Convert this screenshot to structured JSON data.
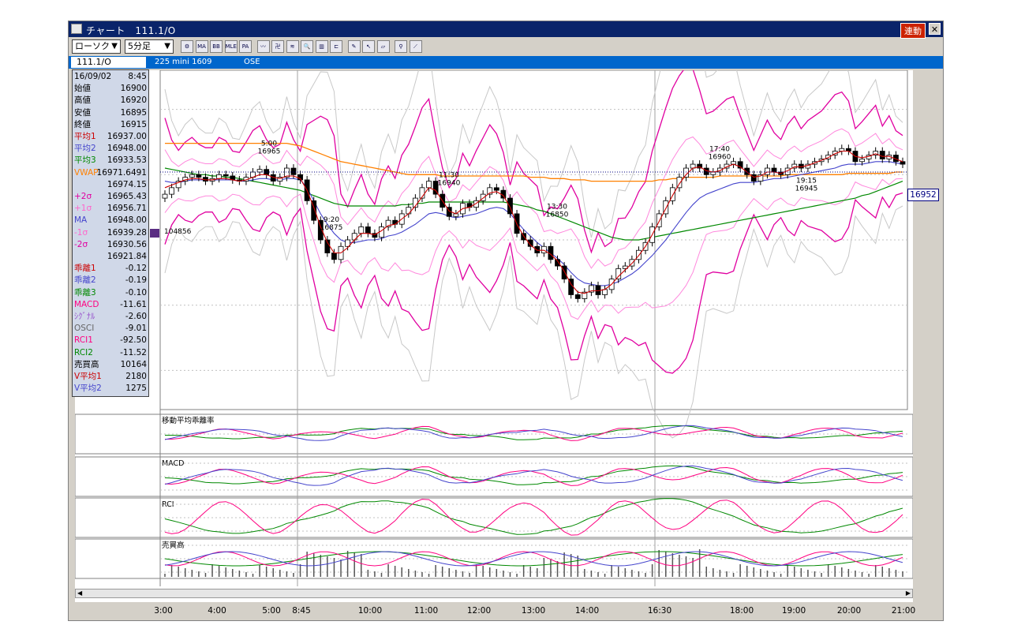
{
  "window": {
    "title": "チャート　111.1/O",
    "rendo_label": "連動",
    "close_label": "✕"
  },
  "toolbar": {
    "type_select": "ローソク",
    "interval_select": "5分足",
    "buttons": [
      {
        "name": "chart-settings-icon",
        "text": "⚙"
      },
      {
        "name": "ma-button",
        "text": "MA"
      },
      {
        "name": "bb-button",
        "text": "BB"
      },
      {
        "name": "mle-button",
        "text": "MLE"
      },
      {
        "name": "pa-button",
        "text": "PA"
      },
      {
        "name": "line-chart-icon",
        "text": "〰"
      },
      {
        "name": "candle-chart-icon",
        "text": "卍"
      },
      {
        "name": "bar-chart-icon",
        "text": "≋"
      },
      {
        "name": "zoom-icon",
        "text": "🔍"
      },
      {
        "name": "indicator-icon",
        "text": "▥"
      },
      {
        "name": "range-icon",
        "text": "⊏"
      },
      {
        "name": "pen-icon",
        "text": "✎"
      },
      {
        "name": "cursor-icon",
        "text": "↖"
      },
      {
        "name": "eraser-icon",
        "text": "▱"
      },
      {
        "name": "search-icon",
        "text": "⚲"
      },
      {
        "name": "draw-line-icon",
        "text": "⟋"
      }
    ]
  },
  "infobar": {
    "symbol": "111.1/O",
    "product": "225 mini 1609",
    "exchange": "OSE"
  },
  "datapanel": {
    "rows": [
      {
        "label": "16/09/02",
        "value": "8:45",
        "color": "#000000"
      },
      {
        "label": "始値",
        "value": "16900",
        "color": "#000000"
      },
      {
        "label": "高値",
        "value": "16920",
        "color": "#000000"
      },
      {
        "label": "安値",
        "value": "16895",
        "color": "#000000"
      },
      {
        "label": "終値",
        "value": "16915",
        "color": "#000000"
      },
      {
        "label": "平均1",
        "value": "16937.00",
        "color": "#cc0000"
      },
      {
        "label": "平均2",
        "value": "16948.00",
        "color": "#4444cc"
      },
      {
        "label": "平均3",
        "value": "16933.53",
        "color": "#008800"
      },
      {
        "label": "VWAP",
        "value": "16971.6491",
        "color": "#ff8000"
      },
      {
        "label": "",
        "value": "16974.15",
        "color": "#000000"
      },
      {
        "label": "+2σ",
        "value": "16965.43",
        "color": "#e000a0"
      },
      {
        "label": "+1σ",
        "value": "16956.71",
        "color": "#ff66cc"
      },
      {
        "label": "MA",
        "value": "16948.00",
        "color": "#4444cc"
      },
      {
        "label": "-1σ",
        "value": "16939.28",
        "color": "#ff66cc"
      },
      {
        "label": "-2σ",
        "value": "16930.56",
        "color": "#e000a0"
      },
      {
        "label": "",
        "value": "16921.84",
        "color": "#000000"
      },
      {
        "label": "乖離1",
        "value": "-0.12",
        "color": "#cc0000"
      },
      {
        "label": "乖離2",
        "value": "-0.19",
        "color": "#4444cc"
      },
      {
        "label": "乖離3",
        "value": "-0.10",
        "color": "#008800"
      },
      {
        "label": "MACD",
        "value": "-11.61",
        "color": "#ff0080"
      },
      {
        "label": "ｼｸﾞﾅﾙ",
        "value": "-2.60",
        "color": "#9955cc"
      },
      {
        "label": "OSCI",
        "value": "-9.01",
        "color": "#666666"
      },
      {
        "label": "RCI1",
        "value": "-92.50",
        "color": "#ff0080"
      },
      {
        "label": "RCI2",
        "value": "-11.52",
        "color": "#008800"
      },
      {
        "label": "売買高",
        "value": "10164",
        "color": "#000000"
      },
      {
        "label": "V平均1",
        "value": "2180",
        "color": "#cc0000"
      },
      {
        "label": "V平均2",
        "value": "1275",
        "color": "#4444cc"
      }
    ]
  },
  "chart_data": [
    {
      "type": "candlestick",
      "title": "",
      "ylim": [
        16770,
        17030
      ],
      "yticks": [
        17000,
        16950,
        16900,
        16850,
        16800
      ],
      "x_ticks": [
        "3:00",
        "4:00",
        "5:00",
        "8:45",
        "10:00",
        "11:00",
        "12:00",
        "13:00",
        "14:00",
        "16:30",
        "18:00",
        "19:00",
        "20:00",
        "21:00"
      ],
      "last_price": "16952",
      "marker_label": "104856",
      "annotations": [
        {
          "time": "5:00",
          "value": 16965
        },
        {
          "time": "11:30",
          "value": 16940
        },
        {
          "time": "9:20",
          "value": 16875
        },
        {
          "time": "13:30",
          "value": 16850
        },
        {
          "time": "17:40",
          "value": 16960
        },
        {
          "time": "19:15",
          "value": 16945
        }
      ],
      "close": [
        16935,
        16940,
        16945,
        16948,
        16950,
        16948,
        16945,
        16947,
        16950,
        16949,
        16946,
        16945,
        16948,
        16952,
        16954,
        16950,
        16945,
        16948,
        16955,
        16950,
        16946,
        16930,
        16915,
        16900,
        16890,
        16885,
        16895,
        16900,
        16905,
        16910,
        16905,
        16902,
        16910,
        16915,
        16912,
        16920,
        16925,
        16932,
        16940,
        16945,
        16935,
        16925,
        16918,
        16920,
        16928,
        16925,
        16930,
        16935,
        16940,
        16938,
        16932,
        16920,
        16905,
        16900,
        16895,
        16890,
        16895,
        16885,
        16880,
        16870,
        16858,
        16855,
        16860,
        16865,
        16858,
        16862,
        16870,
        16878,
        16880,
        16885,
        16892,
        16898,
        16910,
        16920,
        16930,
        16940,
        16948,
        16955,
        16958,
        16955,
        16950,
        16952,
        16955,
        16958,
        16960,
        16955,
        16950,
        16945,
        16950,
        16955,
        16952,
        16950,
        16955,
        16958,
        16955,
        16958,
        16960,
        16962,
        16965,
        16968,
        16970,
        16968,
        16960,
        16962,
        16965,
        16968,
        16962,
        16965,
        16960,
        16958
      ],
      "ma1": [
        16940,
        16942,
        16944,
        16946,
        16947,
        16947,
        16946,
        16946,
        16947,
        16947,
        16946,
        16945,
        16946,
        16948,
        16950,
        16950,
        16948,
        16947,
        16949,
        16949,
        16947,
        16938,
        16925,
        16910,
        16898,
        16890,
        16890,
        16894,
        16900,
        16905,
        16905,
        16904,
        16907,
        16911,
        16912,
        16916,
        16920,
        16926,
        16933,
        16940,
        16938,
        16930,
        16922,
        16920,
        16924,
        16925,
        16928,
        16932,
        16936,
        16937,
        16934,
        16925,
        16912,
        16903,
        16896,
        16892,
        16892,
        16889,
        16884,
        16876,
        16866,
        16860,
        16859,
        16861,
        16861,
        16862,
        16866,
        16872,
        16877,
        16882,
        16888,
        16895,
        16904,
        16914,
        16924,
        16934,
        16943,
        16950,
        16955,
        16956,
        16953,
        16952,
        16953,
        16956,
        16958,
        16956,
        16952,
        16948,
        16949,
        16952,
        16952,
        16951,
        16953,
        16956,
        16956,
        16957,
        16959,
        16961,
        16963,
        16966,
        16968,
        16968,
        16964,
        16963,
        16964,
        16966,
        16964,
        16964,
        16962,
        16960
      ],
      "ma2": [
        16945,
        16944,
        16944,
        16945,
        16946,
        16946,
        16946,
        16946,
        16946,
        16946,
        16946,
        16945,
        16945,
        16946,
        16947,
        16947,
        16946,
        16946,
        16947,
        16947,
        16946,
        16940,
        16930,
        16920,
        16912,
        16905,
        16900,
        16898,
        16898,
        16899,
        16900,
        16900,
        16901,
        16903,
        16904,
        16906,
        16909,
        16912,
        16916,
        16920,
        16921,
        16920,
        16918,
        16917,
        16918,
        16919,
        16920,
        16922,
        16924,
        16925,
        16924,
        16920,
        16914,
        16908,
        16903,
        16898,
        16894,
        16890,
        16886,
        16881,
        16875,
        16870,
        16867,
        16866,
        16865,
        16865,
        16866,
        16868,
        16871,
        16874,
        16878,
        16883,
        16888,
        16894,
        16900,
        16907,
        16914,
        16921,
        16927,
        16932,
        16935,
        16937,
        16939,
        16941,
        16943,
        16944,
        16944,
        16944,
        16945,
        16946,
        16947,
        16947,
        16948,
        16949,
        16950,
        16951,
        16952,
        16953,
        16954,
        16955,
        16957,
        16958,
        16958,
        16958,
        16959,
        16960,
        16960,
        16960,
        16959,
        16958
      ],
      "ma3": [
        16955,
        16954,
        16953,
        16952,
        16951,
        16950,
        16950,
        16949,
        16949,
        16948,
        16948,
        16947,
        16946,
        16945,
        16944,
        16943,
        16942,
        16941,
        16940,
        16939,
        16938,
        16936,
        16934,
        16932,
        16930,
        16928,
        16927,
        16926,
        16926,
        16926,
        16926,
        16926,
        16926,
        16926,
        16926,
        16927,
        16927,
        16928,
        16928,
        16929,
        16929,
        16929,
        16929,
        16929,
        16929,
        16929,
        16929,
        16929,
        16929,
        16929,
        16929,
        16928,
        16927,
        16926,
        16925,
        16923,
        16922,
        16920,
        16918,
        16916,
        16914,
        16912,
        16910,
        16908,
        16906,
        16904,
        16902,
        16901,
        16900,
        16900,
        16900,
        16901,
        16902,
        16903,
        16904,
        16905,
        16906,
        16907,
        16908,
        16909,
        16910,
        16911,
        16912,
        16913,
        16914,
        16915,
        16916,
        16917,
        16918,
        16919,
        16920,
        16921,
        16922,
        16923,
        16924,
        16925,
        16926,
        16927,
        16928,
        16929,
        16930,
        16931,
        16932,
        16934,
        16935,
        16937,
        16939,
        16941,
        16943,
        16945
      ],
      "vwap": [
        16974,
        16974,
        16974,
        16974,
        16974,
        16974,
        16974,
        16974,
        16974,
        16974,
        16974,
        16974,
        16974,
        16974,
        16974,
        16974,
        16974,
        16974,
        16974,
        16973,
        16972,
        16970,
        16968,
        16966,
        16964,
        16962,
        16960,
        16959,
        16958,
        16957,
        16956,
        16955,
        16954,
        16953,
        16952,
        16951,
        16950,
        16950,
        16950,
        16950,
        16950,
        16949,
        16949,
        16949,
        16949,
        16949,
        16949,
        16949,
        16949,
        16949,
        16949,
        16949,
        16949,
        16949,
        16948,
        16948,
        16948,
        16947,
        16947,
        16947,
        16946,
        16946,
        16946,
        16945,
        16945,
        16945,
        16945,
        16945,
        16945,
        16945,
        16945,
        16945,
        16945,
        16946,
        16946,
        16947,
        16947,
        16948,
        16948,
        16948,
        16948,
        16948,
        16949,
        16949,
        16949,
        16949,
        16949,
        16949,
        16949,
        16949,
        16949,
        16949,
        16950,
        16950,
        16950,
        16950,
        16950,
        16950,
        16950,
        16950,
        16950,
        16951,
        16951,
        16951,
        16951,
        16951,
        16951,
        16951,
        16952,
        16952
      ]
    },
    {
      "type": "line",
      "title": "移動平均乖離率",
      "yticks": [
        "0"
      ]
    },
    {
      "type": "line",
      "title": "MACD",
      "yticks": [
        "20",
        "0",
        "-20"
      ]
    },
    {
      "type": "line",
      "title": "RCI",
      "yticks": [
        "80",
        "0",
        "-80"
      ]
    },
    {
      "type": "bar",
      "title": "売買高",
      "yticks": [
        "12000",
        "8000",
        "4000"
      ]
    }
  ],
  "colors": {
    "ma1": "#cc0000",
    "ma2": "#4444cc",
    "ma3": "#008800",
    "vwap": "#ff8000",
    "bb2": "#e000a0",
    "bb1": "#ff88dd",
    "bb3": "#c8c8c8",
    "grid": "#c0c0c0"
  }
}
